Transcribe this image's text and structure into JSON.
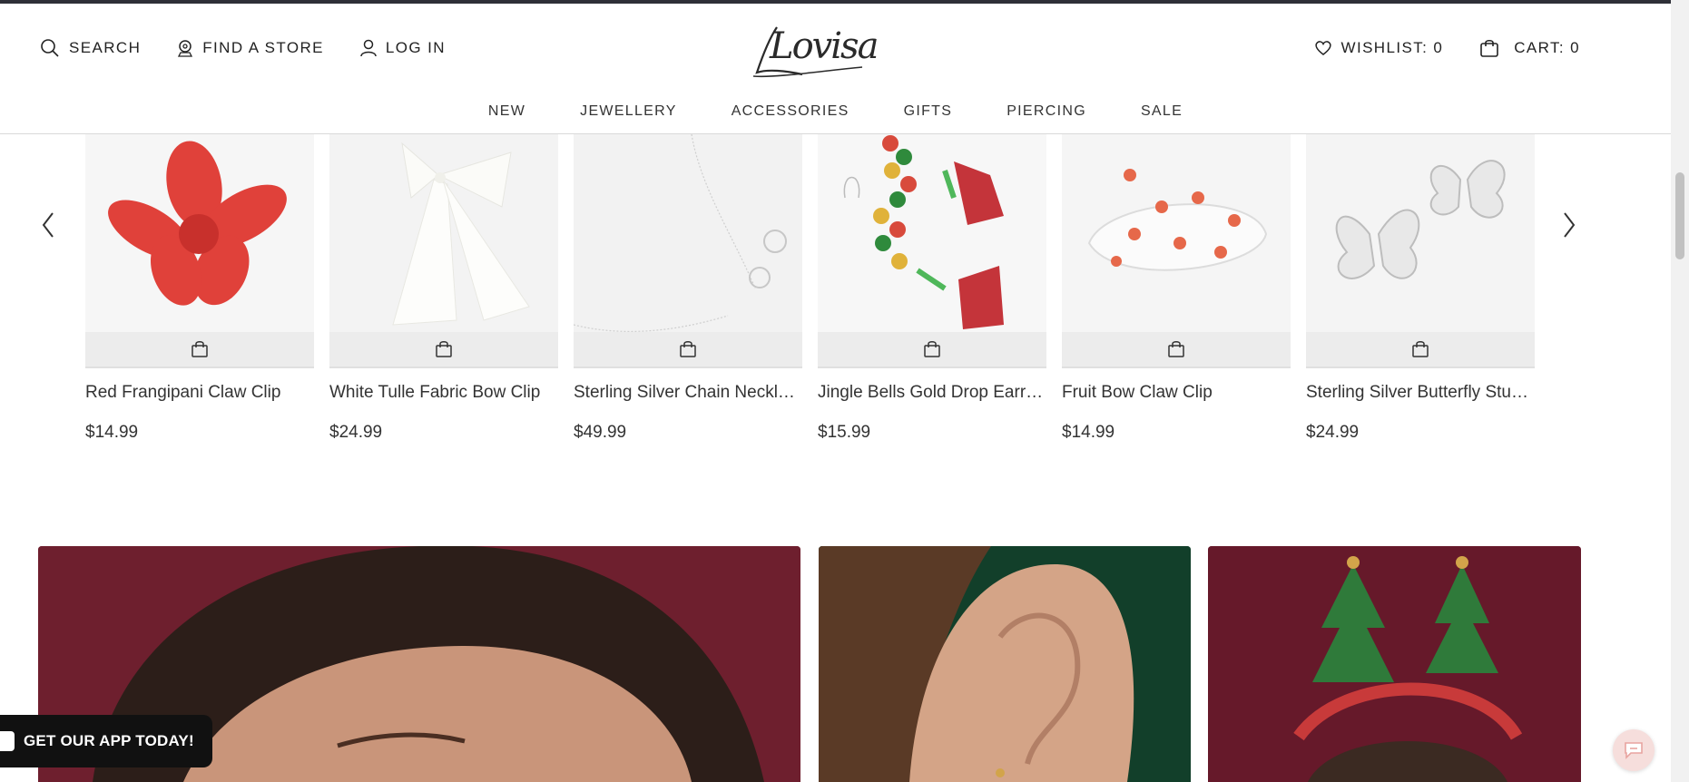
{
  "header": {
    "search_label": "SEARCH",
    "find_store_label": "FIND A STORE",
    "login_label": "LOG IN",
    "logo_text": "Lovisa",
    "wishlist_label": "WISHLIST: 0",
    "cart_label": "CART: 0"
  },
  "nav": {
    "items": [
      {
        "label": "NEW"
      },
      {
        "label": "JEWELLERY"
      },
      {
        "label": "ACCESSORIES"
      },
      {
        "label": "GIFTS"
      },
      {
        "label": "PIERCING"
      },
      {
        "label": "SALE"
      }
    ]
  },
  "carousel": {
    "products": [
      {
        "name": "Red Frangipani Claw Clip",
        "price": "$14.99"
      },
      {
        "name": "White Tulle Fabric Bow Clip",
        "price": "$24.99"
      },
      {
        "name": "Sterling Silver Chain Necklace...",
        "price": "$49.99"
      },
      {
        "name": "Jingle Bells Gold Drop Earrings",
        "price": "$15.99"
      },
      {
        "name": "Fruit Bow Claw Clip",
        "price": "$14.99"
      },
      {
        "name": "Sterling Silver Butterfly Stud...",
        "price": "$24.99"
      }
    ]
  },
  "app_banner": {
    "label": "GET OUR APP TODAY!"
  },
  "icons": [
    "search-icon",
    "location-pin-icon",
    "user-icon",
    "heart-icon",
    "bag-icon",
    "chevron-left-icon",
    "chevron-right-icon",
    "add-to-bag-icon",
    "chat-icon"
  ],
  "colors": {
    "topline": "#2f3038",
    "banner_red": "#6e1f2e",
    "banner_green": "#123f2a",
    "chat_bg": "#f6dedc"
  }
}
